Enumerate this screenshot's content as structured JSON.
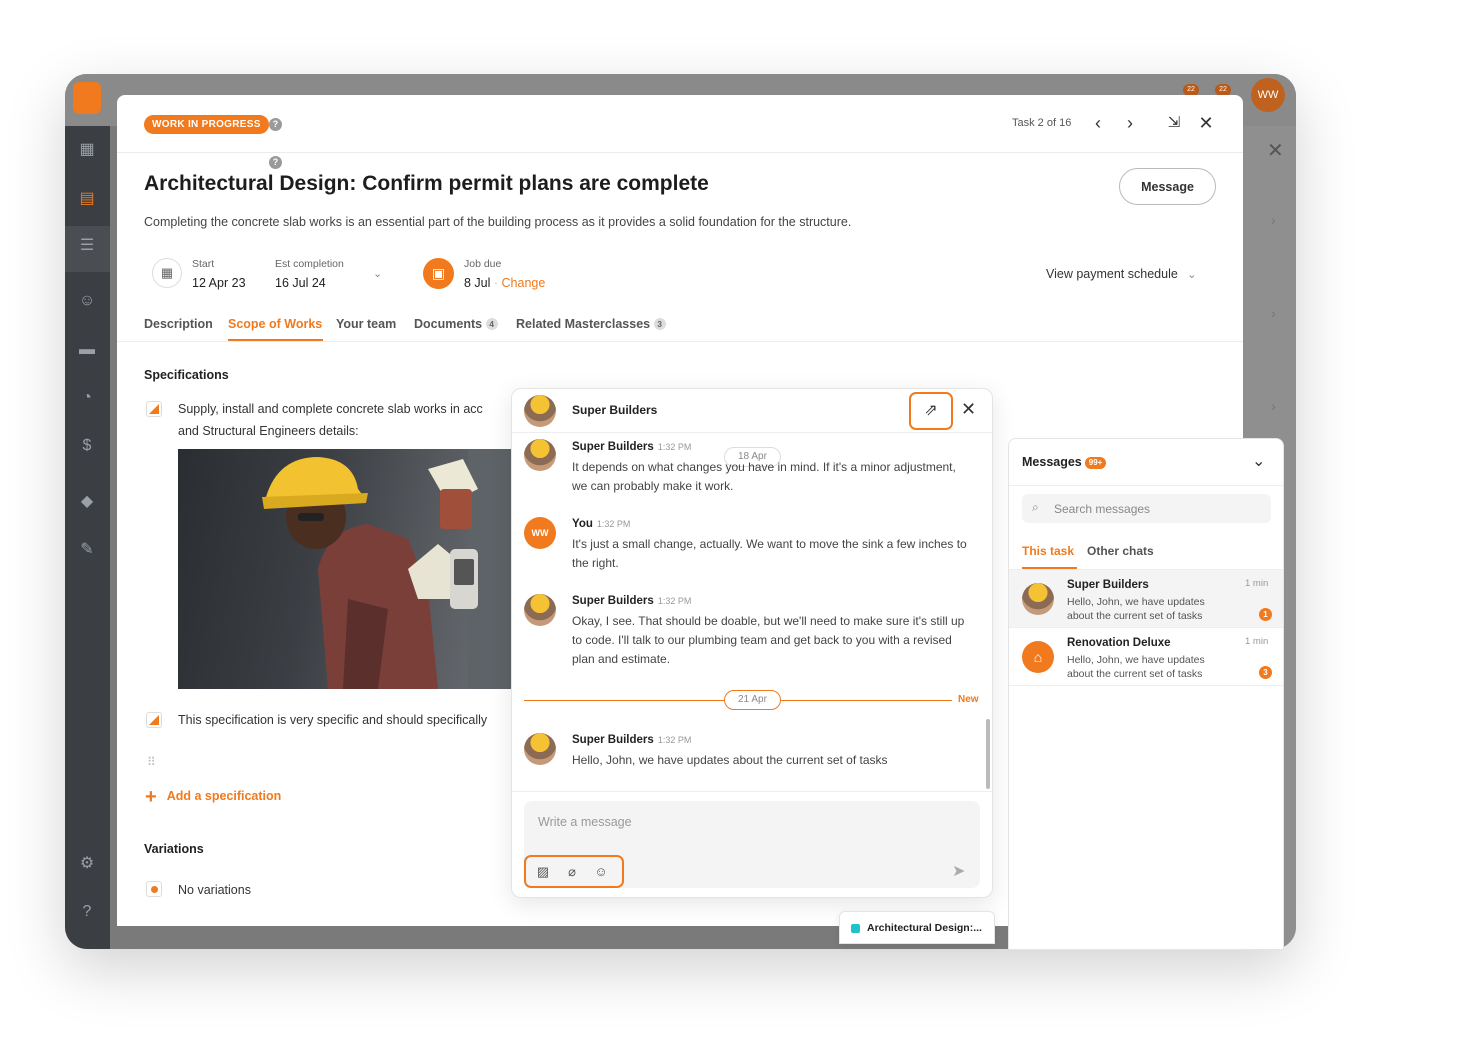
{
  "app": {
    "avatar_initials": "WW",
    "notif_count_1": "22",
    "notif_count_2": "22"
  },
  "task": {
    "status": "WORK IN PROGRESS",
    "help": "?",
    "counter": "Task 2 of 16",
    "title": "Architectural Design: Confirm permit plans are complete",
    "description": "Completing the concrete slab works is an essential part of the building process as it provides a solid foundation for the structure.",
    "message_button": "Message",
    "start_label": "Start",
    "start_value": "12 Apr 23",
    "est_label": "Est completion",
    "est_value": "16 Jul 24",
    "due_label": "Job due",
    "due_value": "8 Jul",
    "due_sep": " · ",
    "due_change": "Change",
    "payment_schedule": "View payment schedule"
  },
  "tabs": [
    {
      "label": "Description"
    },
    {
      "label": "Scope of Works"
    },
    {
      "label": "Your team"
    },
    {
      "label": "Documents",
      "count": "4"
    },
    {
      "label": "Related Masterclasses",
      "count": "3"
    }
  ],
  "scope": {
    "specs_heading": "Specifications",
    "spec1_line1": "Supply, install and complete concrete slab works in acc",
    "spec1_line2": "and Structural Engineers details:",
    "spec2": "This specification is very specific and should specifically",
    "add_spec": "Add a specification",
    "variations_heading": "Variations",
    "no_variations": "No variations"
  },
  "chat": {
    "contact": "Super Builders",
    "date_1": "18 Apr",
    "date_2": "21 Apr",
    "new_label": "New",
    "compose_placeholder": "Write a message",
    "messages": [
      {
        "sender": "Super Builders",
        "time": "1:32 PM",
        "text": "It depends on what changes you have in mind. If it's a minor adjustment, we can probably make it work."
      },
      {
        "sender": "You",
        "time": "1:32 PM",
        "text": "It's just a small change, actually. We want to move the sink a few inches to the right."
      },
      {
        "sender": "Super Builders",
        "time": "1:32 PM",
        "text": "Okay, I see. That should be doable, but we'll need to make sure it's still up to code. I'll talk to our plumbing team and get back to you with a revised plan and estimate."
      },
      {
        "sender": "Super Builders",
        "time": "1:32 PM",
        "text": "Hello, John, we have updates about the current set of tasks"
      }
    ]
  },
  "messages_panel": {
    "title": "Messages",
    "count": "99+",
    "search_placeholder": "Search messages",
    "tab_this": "This task",
    "tab_other": "Other chats",
    "conversations": [
      {
        "name": "Super Builders",
        "preview": "Hello, John, we have updates about the current set of tasks",
        "time": "1 min",
        "unread": "1"
      },
      {
        "name": "Renovation Deluxe",
        "preview": "Hello, John, we have updates about the current set of tasks",
        "time": "1 min",
        "unread": "3"
      }
    ]
  },
  "tray": {
    "label": "Architectural Design:..."
  },
  "colors": {
    "accent": "#f07a1d",
    "sidebar": "#3b3e43",
    "tray_dot": "#1fc3c9"
  }
}
